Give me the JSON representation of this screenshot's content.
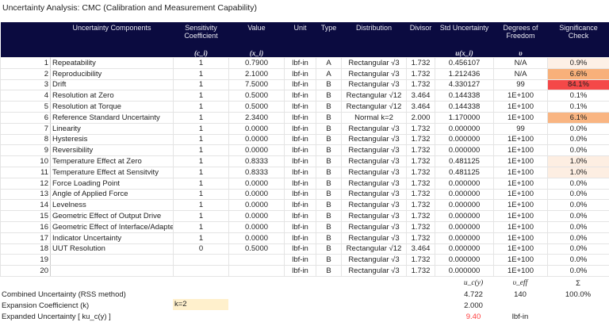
{
  "title": "Uncertainty Analysis: CMC (Calibration and Measurement Capability)",
  "headers": {
    "components": "Uncertainty Components",
    "sensitivity": "Sensitivity Coefficient",
    "sensitivity_sym": "(c_i)",
    "value": "Value",
    "value_sym": "(x_i)",
    "unit": "Unit",
    "type": "Type",
    "distribution": "Distribution",
    "divisor": "Divisor",
    "std_unc": "Std Uncertainty",
    "std_unc_sym": "u(x_i)",
    "dof": "Degrees of Freedom",
    "dof_sym": "υ",
    "sig": "Significance Check"
  },
  "colors": {
    "header_bg": "#0b0b40",
    "expanded_value": "#ff3b3b",
    "k_input_bg": "#fff0cc"
  },
  "rows": [
    {
      "n": "1",
      "name": "Repeatability",
      "c": "1",
      "x": "0.7900",
      "unit": "lbf-in",
      "type": "A",
      "dist": "Rectangular √3",
      "div": "1.732",
      "u": "0.456107",
      "dof": "N/A",
      "sig": "0.9%",
      "sig_color": "#fdf0e6"
    },
    {
      "n": "2",
      "name": "Reproducibility",
      "c": "1",
      "x": "2.1000",
      "unit": "lbf-in",
      "type": "A",
      "dist": "Rectangular √3",
      "div": "1.732",
      "u": "1.212436",
      "dof": "N/A",
      "sig": "6.6%",
      "sig_color": "#f8b07a"
    },
    {
      "n": "3",
      "name": "Drift",
      "c": "1",
      "x": "7.5000",
      "unit": "lbf-in",
      "type": "B",
      "dist": "Rectangular √3",
      "div": "1.732",
      "u": "4.330127",
      "dof": "99",
      "sig": "84.1%",
      "sig_color": "#f44848"
    },
    {
      "n": "4",
      "name": "Resolution at Zero",
      "c": "1",
      "x": "0.5000",
      "unit": "lbf-in",
      "type": "B",
      "dist": "Rectangular √12",
      "div": "3.464",
      "u": "0.144338",
      "dof": "1E+100",
      "sig": "0.1%",
      "sig_color": "#ffffff"
    },
    {
      "n": "5",
      "name": "Resolution at Torque",
      "c": "1",
      "x": "0.5000",
      "unit": "lbf-in",
      "type": "B",
      "dist": "Rectangular √12",
      "div": "3.464",
      "u": "0.144338",
      "dof": "1E+100",
      "sig": "0.1%",
      "sig_color": "#ffffff"
    },
    {
      "n": "6",
      "name": "Reference Standard Uncertainty",
      "c": "1",
      "x": "2.3400",
      "unit": "lbf-in",
      "type": "B",
      "dist": "Normal k=2",
      "div": "2.000",
      "u": "1.170000",
      "dof": "1E+100",
      "sig": "6.1%",
      "sig_color": "#f9b582"
    },
    {
      "n": "7",
      "name": "Linearity",
      "c": "1",
      "x": "0.0000",
      "unit": "lbf-in",
      "type": "B",
      "dist": "Rectangular √3",
      "div": "1.732",
      "u": "0.000000",
      "dof": "99",
      "sig": "0.0%",
      "sig_color": "#ffffff"
    },
    {
      "n": "8",
      "name": "Hysteresis",
      "c": "1",
      "x": "0.0000",
      "unit": "lbf-in",
      "type": "B",
      "dist": "Rectangular √3",
      "div": "1.732",
      "u": "0.000000",
      "dof": "1E+100",
      "sig": "0.0%",
      "sig_color": "#ffffff"
    },
    {
      "n": "9",
      "name": "Reversibility",
      "c": "1",
      "x": "0.0000",
      "unit": "lbf-in",
      "type": "B",
      "dist": "Rectangular √3",
      "div": "1.732",
      "u": "0.000000",
      "dof": "1E+100",
      "sig": "0.0%",
      "sig_color": "#ffffff"
    },
    {
      "n": "10",
      "name": "Temperature Effect at Zero",
      "c": "1",
      "x": "0.8333",
      "unit": "lbf-in",
      "type": "B",
      "dist": "Rectangular √3",
      "div": "1.732",
      "u": "0.481125",
      "dof": "1E+100",
      "sig": "1.0%",
      "sig_color": "#fdeee2"
    },
    {
      "n": "11",
      "name": "Temperature Effect at Sensitvity",
      "c": "1",
      "x": "0.8333",
      "unit": "lbf-in",
      "type": "B",
      "dist": "Rectangular √3",
      "div": "1.732",
      "u": "0.481125",
      "dof": "1E+100",
      "sig": "1.0%",
      "sig_color": "#fdeee2"
    },
    {
      "n": "12",
      "name": "Force Loading Point",
      "c": "1",
      "x": "0.0000",
      "unit": "lbf-in",
      "type": "B",
      "dist": "Rectangular √3",
      "div": "1.732",
      "u": "0.000000",
      "dof": "1E+100",
      "sig": "0.0%",
      "sig_color": "#ffffff"
    },
    {
      "n": "13",
      "name": "Angle of Applied Force",
      "c": "1",
      "x": "0.0000",
      "unit": "lbf-in",
      "type": "B",
      "dist": "Rectangular √3",
      "div": "1.732",
      "u": "0.000000",
      "dof": "1E+100",
      "sig": "0.0%",
      "sig_color": "#ffffff"
    },
    {
      "n": "14",
      "name": "Levelness",
      "c": "1",
      "x": "0.0000",
      "unit": "lbf-in",
      "type": "B",
      "dist": "Rectangular √3",
      "div": "1.732",
      "u": "0.000000",
      "dof": "1E+100",
      "sig": "0.0%",
      "sig_color": "#ffffff"
    },
    {
      "n": "15",
      "name": "Geometric Effect of Output Drive",
      "c": "1",
      "x": "0.0000",
      "unit": "lbf-in",
      "type": "B",
      "dist": "Rectangular √3",
      "div": "1.732",
      "u": "0.000000",
      "dof": "1E+100",
      "sig": "0.0%",
      "sig_color": "#ffffff"
    },
    {
      "n": "16",
      "name": "Geometric Effect of Interface/Adapter",
      "c": "1",
      "x": "0.0000",
      "unit": "lbf-in",
      "type": "B",
      "dist": "Rectangular √3",
      "div": "1.732",
      "u": "0.000000",
      "dof": "1E+100",
      "sig": "0.0%",
      "sig_color": "#ffffff"
    },
    {
      "n": "17",
      "name": "Indicator Uncertainty",
      "c": "1",
      "x": "0.0000",
      "unit": "lbf-in",
      "type": "B",
      "dist": "Rectangular √3",
      "div": "1.732",
      "u": "0.000000",
      "dof": "1E+100",
      "sig": "0.0%",
      "sig_color": "#ffffff"
    },
    {
      "n": "18",
      "name": "UUT Resolution",
      "c": "0",
      "x": "0.5000",
      "unit": "lbf-in",
      "type": "B",
      "dist": "Rectangular √12",
      "div": "3.464",
      "u": "0.000000",
      "dof": "1E+100",
      "sig": "0.0%",
      "sig_color": "#ffffff"
    },
    {
      "n": "19",
      "name": "",
      "c": "",
      "x": "",
      "unit": "lbf-in",
      "type": "B",
      "dist": "Rectangular √3",
      "div": "1.732",
      "u": "0.000000",
      "dof": "1E+100",
      "sig": "0.0%",
      "sig_color": "#ffffff"
    },
    {
      "n": "20",
      "name": "",
      "c": "",
      "x": "",
      "unit": "lbf-in",
      "type": "B",
      "dist": "Rectangular √3",
      "div": "1.732",
      "u": "0.000000",
      "dof": "1E+100",
      "sig": "0.0%",
      "sig_color": "#ffffff"
    }
  ],
  "summary": {
    "uc_sym": "u_c(y)",
    "veff_sym": "υ_eff",
    "sigma_sym": "Σ",
    "combined_label": "Combined Uncertainty (RSS method)",
    "combined_value": "4.722",
    "veff_value": "140",
    "sigma_value": "100.0%",
    "k_label": "Expansion Coefficienct (k)",
    "k_input": "k=2",
    "k_value": "2.000",
    "expanded_label": "Expanded Uncertainty [ ku_c(y) ]",
    "expanded_value": "9.40",
    "expanded_unit": "lbf-in"
  }
}
